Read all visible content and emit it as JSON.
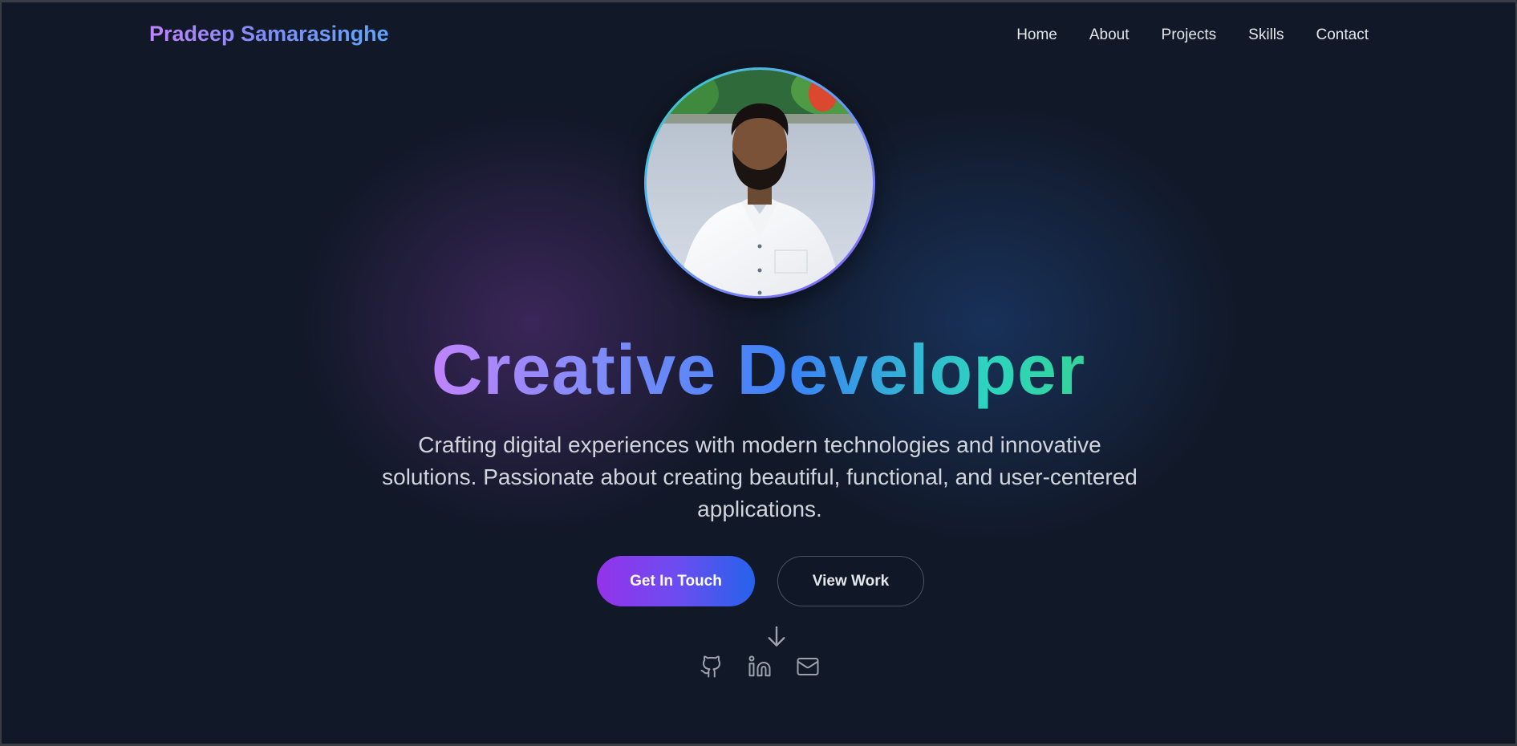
{
  "nav": {
    "brand": "Pradeep Samarasinghe",
    "links": [
      "Home",
      "About",
      "Projects",
      "Skills",
      "Contact"
    ]
  },
  "hero": {
    "headline": "Creative Developer",
    "tagline": "Crafting digital experiences with modern technologies and innovative solutions. Passionate about creating beautiful, functional, and user-centered applications.",
    "primary_button": "Get In Touch",
    "secondary_button": "View Work"
  },
  "icons": {
    "scroll": "arrow-down-icon",
    "social": [
      "github-icon",
      "linkedin-icon",
      "mail-icon"
    ]
  },
  "colors": {
    "background": "#111827",
    "accent_purple": "#9333ea",
    "accent_blue": "#2563eb",
    "accent_teal": "#2dd4bf",
    "text_muted": "#d1d5db"
  }
}
